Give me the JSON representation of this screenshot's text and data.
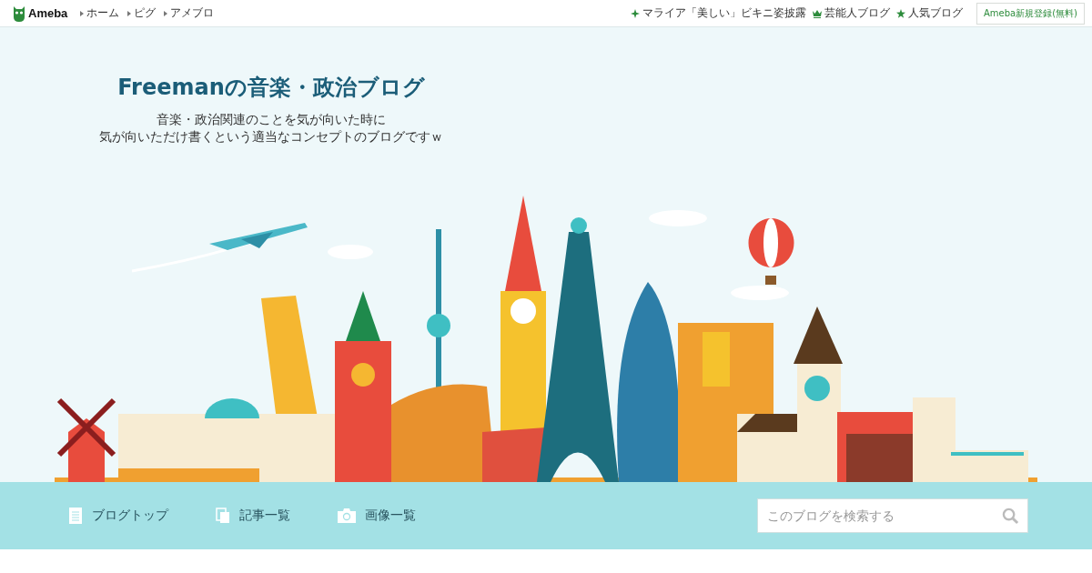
{
  "topbar": {
    "logo": "Ameba",
    "nav_links": [
      "ホーム",
      "ピグ",
      "アメブロ"
    ],
    "promos": [
      "マライア「美しい」ビキニ姿披露",
      "芸能人ブログ",
      "人気ブログ"
    ],
    "register_button": "Ameba新規登録(無料)"
  },
  "header": {
    "title": "Freemanの音楽・政治ブログ",
    "description": [
      "音楽・政治関連のことを気が向いた時に",
      "気が向いただけ書くという適当なコンセプトのブログですｗ"
    ]
  },
  "blog_nav": [
    "ブログトップ",
    "記事一覧",
    "画像一覧"
  ],
  "search": {
    "placeholder": "このブログを検索する"
  }
}
